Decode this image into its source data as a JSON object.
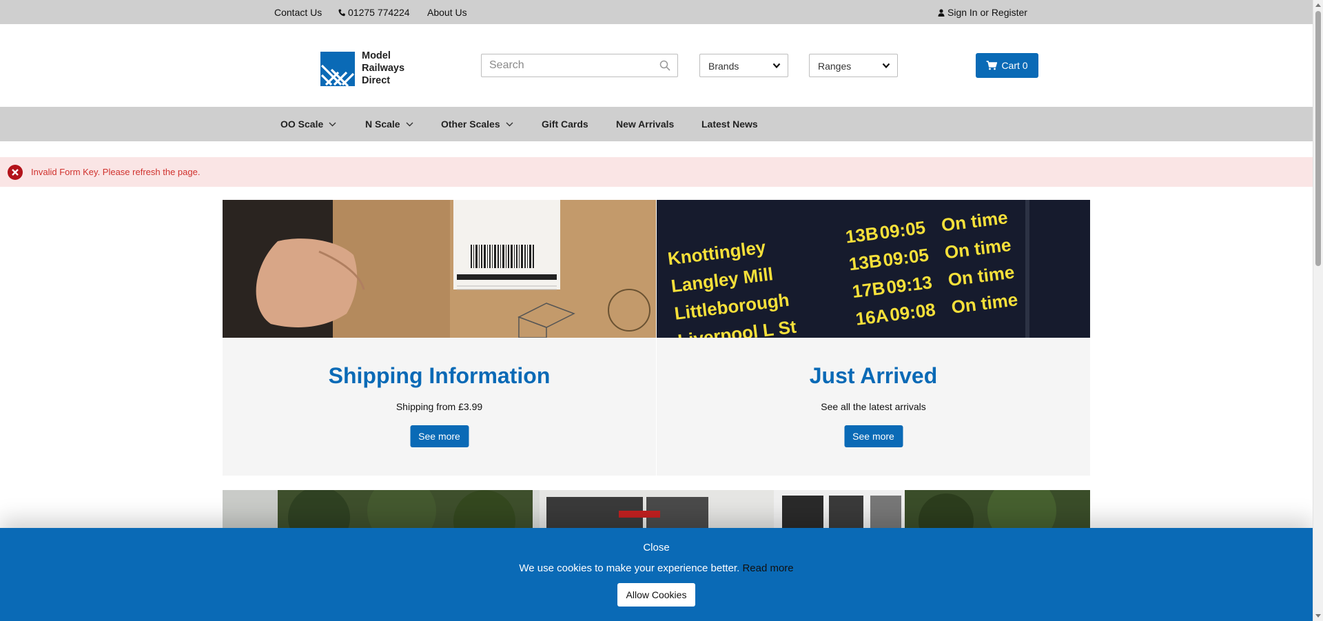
{
  "topbar": {
    "contact_label": "Contact Us",
    "phone_label": "01275 774224",
    "about_label": "About Us",
    "signin_label": "Sign In or Register"
  },
  "header": {
    "logo_lines": [
      "Model",
      "Railways",
      "Direct"
    ],
    "search_placeholder": "Search",
    "brands_label": "Brands",
    "ranges_label": "Ranges",
    "cart_label": "Cart 0"
  },
  "nav": {
    "items": [
      {
        "label": "OO Scale",
        "dropdown": true
      },
      {
        "label": "N Scale",
        "dropdown": true
      },
      {
        "label": "Other Scales",
        "dropdown": true
      },
      {
        "label": "Gift Cards",
        "dropdown": false
      },
      {
        "label": "New Arrivals",
        "dropdown": false
      },
      {
        "label": "Latest News",
        "dropdown": false
      }
    ]
  },
  "error": {
    "message": "Invalid Form Key. Please refresh the page."
  },
  "promos": [
    {
      "title": "Shipping Information",
      "text": "Shipping from £3.99",
      "button": "See more"
    },
    {
      "title": "Just Arrived",
      "text": "See all the latest arrivals",
      "button": "See more"
    }
  ],
  "departures_board": [
    {
      "station": "Knottingley",
      "plat": "13B",
      "time": "09:05",
      "status": "On time"
    },
    {
      "station": "Langley Mill",
      "plat": "13B",
      "time": "09:05",
      "status": "On time"
    },
    {
      "station": "Littleborough",
      "plat": "17B",
      "time": "09:13",
      "status": "On time"
    },
    {
      "station": "Liverpool L St",
      "plat": "16A",
      "time": "09:08",
      "status": "On time"
    }
  ],
  "cookie": {
    "close_label": "Close",
    "message": "We use cookies to make your experience better.",
    "read_more": "Read more",
    "allow_label": "Allow Cookies"
  },
  "colors": {
    "brand_blue": "#0a6ab6",
    "bar_grey": "#cfcfcf",
    "error_bg": "#fae5e5",
    "error_text": "#d0312d"
  }
}
